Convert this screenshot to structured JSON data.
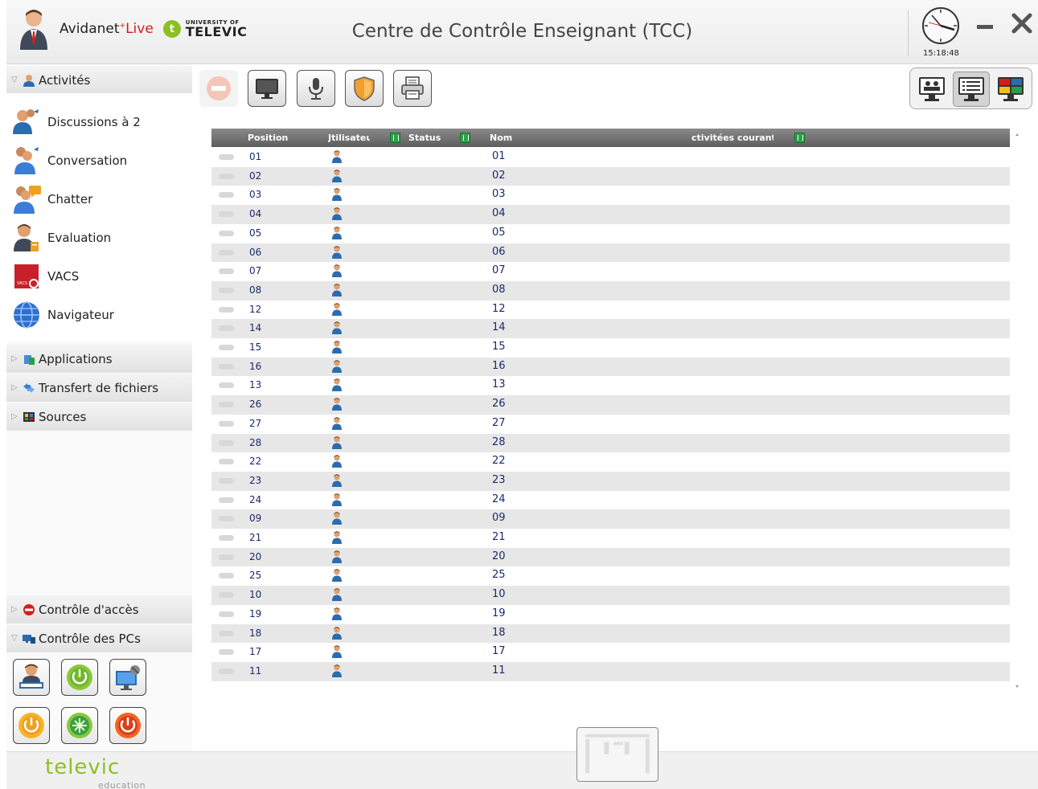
{
  "header": {
    "brand_name": "Avidanet",
    "brand_live": "Live",
    "televic_badge": "t",
    "university_line1": "UNIVERSITY OF",
    "university_line2": "TELEVIC",
    "title": "Centre de Contrôle Enseignant (TCC)",
    "clock_time": "15:18:48"
  },
  "sidebar": {
    "activities_label": "Activités",
    "activities": [
      {
        "label": "Discussions à 2",
        "icon": "pair-discussion-icon"
      },
      {
        "label": "Conversation",
        "icon": "conversation-icon"
      },
      {
        "label": "Chatter",
        "icon": "chat-icon"
      },
      {
        "label": "Evaluation",
        "icon": "evaluation-icon"
      },
      {
        "label": "VACS",
        "icon": "vacs-icon"
      },
      {
        "label": "Navigateur",
        "icon": "globe-icon"
      }
    ],
    "applications_label": "Applications",
    "file_transfer_label": "Transfert de fichiers",
    "sources_label": "Sources",
    "access_control_label": "Contrôle d'accès",
    "pc_control_label": "Contrôle des PCs",
    "vacs_text": "VACS"
  },
  "colors": {
    "accent_green": "#8cbf26",
    "brand_red": "#d0201b",
    "header_gray": "#5d5d5d",
    "row_text": "#1a2a6a"
  },
  "table": {
    "columns": [
      "Position",
      "Jtilisateu",
      "Status",
      "Nom",
      "ctivitées courante"
    ],
    "rows": [
      {
        "position": "01",
        "nom": "01"
      },
      {
        "position": "02",
        "nom": "02"
      },
      {
        "position": "03",
        "nom": "03"
      },
      {
        "position": "04",
        "nom": "04"
      },
      {
        "position": "05",
        "nom": "05"
      },
      {
        "position": "06",
        "nom": "06"
      },
      {
        "position": "07",
        "nom": "07"
      },
      {
        "position": "08",
        "nom": "08"
      },
      {
        "position": "12",
        "nom": "12"
      },
      {
        "position": "14",
        "nom": "14"
      },
      {
        "position": "15",
        "nom": "15"
      },
      {
        "position": "16",
        "nom": "16"
      },
      {
        "position": "13",
        "nom": "13"
      },
      {
        "position": "26",
        "nom": "26"
      },
      {
        "position": "27",
        "nom": "27"
      },
      {
        "position": "28",
        "nom": "28"
      },
      {
        "position": "22",
        "nom": "22"
      },
      {
        "position": "23",
        "nom": "23"
      },
      {
        "position": "24",
        "nom": "24"
      },
      {
        "position": "09",
        "nom": "09"
      },
      {
        "position": "21",
        "nom": "21"
      },
      {
        "position": "20",
        "nom": "20"
      },
      {
        "position": "25",
        "nom": "25"
      },
      {
        "position": "10",
        "nom": "10"
      },
      {
        "position": "19",
        "nom": "19"
      },
      {
        "position": "18",
        "nom": "18"
      },
      {
        "position": "17",
        "nom": "17"
      },
      {
        "position": "11",
        "nom": "11"
      }
    ]
  },
  "footer": {
    "logo_text": "televic",
    "logo_sub": "education"
  }
}
